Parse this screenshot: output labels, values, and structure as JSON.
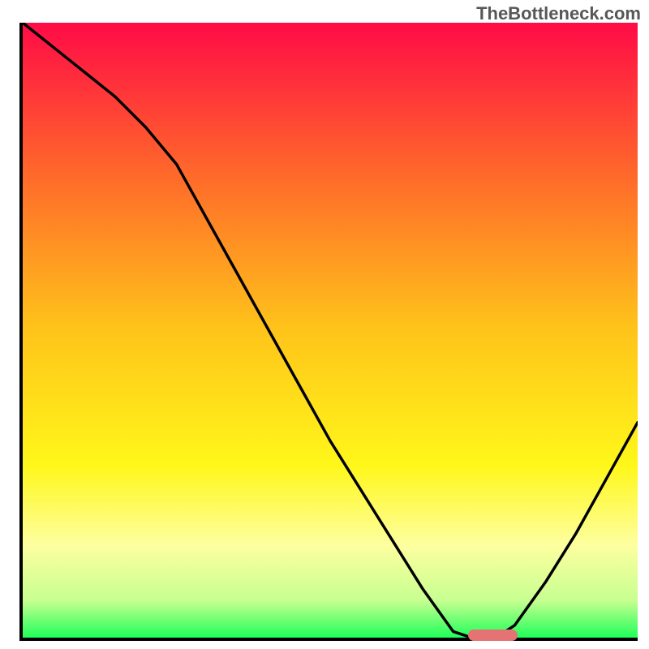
{
  "watermark": "TheBottleneck.com",
  "chart_data": {
    "type": "line",
    "title": "",
    "xlabel": "",
    "ylabel": "",
    "xlim": [
      0,
      100
    ],
    "ylim": [
      0,
      100
    ],
    "x": [
      0,
      5,
      10,
      15,
      20,
      25,
      30,
      35,
      40,
      45,
      50,
      55,
      60,
      65,
      70,
      73,
      77,
      80,
      85,
      90,
      95,
      100
    ],
    "values": [
      100,
      96,
      92,
      88,
      83,
      77,
      68,
      59,
      50,
      41,
      32,
      24,
      16,
      8,
      1,
      0,
      0,
      2,
      9,
      17,
      26,
      35
    ],
    "gradient_stops": [
      {
        "pos": 0,
        "color": "#ff0b46"
      },
      {
        "pos": 25,
        "color": "#ff6a2a"
      },
      {
        "pos": 50,
        "color": "#ffc41a"
      },
      {
        "pos": 72,
        "color": "#fff71a"
      },
      {
        "pos": 85,
        "color": "#fdffa0"
      },
      {
        "pos": 94,
        "color": "#c7ff90"
      },
      {
        "pos": 100,
        "color": "#1fff5a"
      }
    ],
    "marker": {
      "x_start": 72,
      "x_end": 80,
      "y": 0.5,
      "color": "#e57373"
    }
  }
}
